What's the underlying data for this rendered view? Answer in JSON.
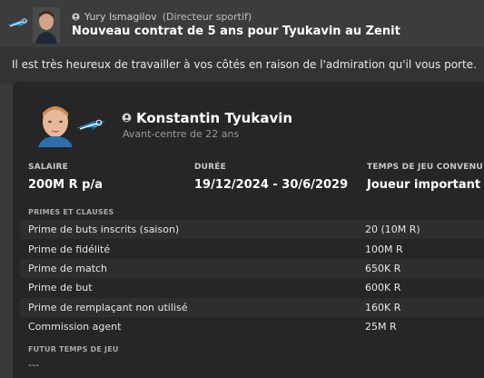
{
  "header": {
    "sender_name": "Yury Ismagilov",
    "sender_role": "(Directeur sportif)",
    "subject": "Nouveau contrat de 5 ans pour Tyukavin au Zenit"
  },
  "message": {
    "text": "Il est très heureux de travailler à vos côtés en raison de l'admiration qu'il vous porte."
  },
  "player": {
    "name": "Konstantin Tyukavin",
    "description": "Avant-centre de 22 ans"
  },
  "contract": {
    "salary_label": "SALAIRE",
    "salary_value": "200M R p/a",
    "duration_label": "DURÉE",
    "duration_value": "19/12/2024 - 30/6/2029",
    "playing_time_label": "TEMPS DE JEU CONVENU",
    "playing_time_value": "Joueur important"
  },
  "bonuses": {
    "label": "PRIMES ET CLAUSES",
    "rows": [
      {
        "name": "Prime de buts inscrits (saison)",
        "value": "20 (10M R)"
      },
      {
        "name": "Prime de fidélité",
        "value": "100M R"
      },
      {
        "name": "Prime de match",
        "value": "650K R"
      },
      {
        "name": "Prime de but",
        "value": "600K R"
      },
      {
        "name": "Prime de remplaçant non utilisé",
        "value": "160K R"
      },
      {
        "name": "Commission agent",
        "value": "25M R"
      }
    ]
  },
  "future": {
    "label": "FUTUR TEMPS DE JEU",
    "value": "---"
  },
  "colors": {
    "zenit_blue": "#2b8fd6",
    "background": "#3a3a3a",
    "card": "#262626"
  }
}
